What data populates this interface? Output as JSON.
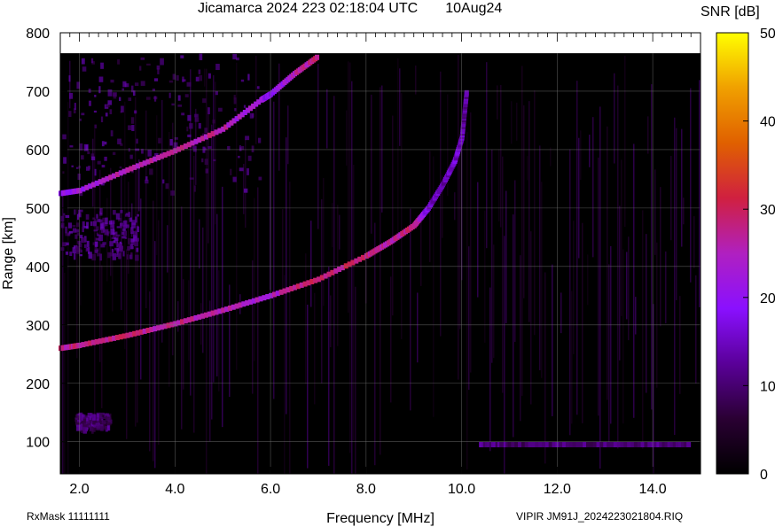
{
  "header": {
    "title": "Jicamarca 2024 223 02:18:04 UTC       10Aug24",
    "colorbar_label": "SNR [dB]"
  },
  "footer": {
    "left": "RxMask 11111111",
    "right": "VIPIR  JM91J_2024223021804.RIQ"
  },
  "chart_data": {
    "type": "heatmap",
    "xlabel": "Frequency [MHz]",
    "ylabel": "Range [km]",
    "xlim": [
      1.6,
      15.0
    ],
    "ylim": [
      45,
      800
    ],
    "data_top_range": 765,
    "x_ticks": [
      2.0,
      4.0,
      6.0,
      8.0,
      10.0,
      12.0,
      14.0
    ],
    "x_tick_labels": [
      "2.0",
      "4.0",
      "6.0",
      "8.0",
      "10.0",
      "12.0",
      "14.0"
    ],
    "y_ticks": [
      100,
      200,
      300,
      400,
      500,
      600,
      700,
      800
    ],
    "y_tick_labels": [
      "100",
      "200",
      "300",
      "400",
      "500",
      "600",
      "700",
      "800"
    ],
    "grid": true,
    "colorbar": {
      "range": [
        0,
        50
      ],
      "ticks": [
        0,
        10,
        20,
        30,
        40,
        50
      ],
      "tick_labels": [
        "0",
        "10",
        "20",
        "30",
        "40",
        "50"
      ],
      "colormap": [
        "#000000",
        "#2a0033",
        "#5a0099",
        "#8a10ff",
        "#b020c0",
        "#d02040",
        "#e06000",
        "#f0a000",
        "#ffff00"
      ]
    },
    "traces": [
      {
        "name": "F-region O-trace",
        "points": [
          [
            1.6,
            260
          ],
          [
            2.0,
            265
          ],
          [
            3.0,
            282
          ],
          [
            4.0,
            302
          ],
          [
            5.0,
            325
          ],
          [
            6.0,
            350
          ],
          [
            7.0,
            378
          ],
          [
            8.0,
            418
          ],
          [
            8.5,
            442
          ],
          [
            9.0,
            470
          ],
          [
            9.3,
            500
          ],
          [
            9.6,
            540
          ],
          [
            9.85,
            580
          ],
          [
            10.0,
            620
          ],
          [
            10.05,
            660
          ],
          [
            10.1,
            700
          ]
        ],
        "snr_db": [
          27,
          28,
          28,
          27,
          26,
          24,
          30,
          28,
          27,
          28,
          16,
          14,
          16,
          14,
          12,
          12
        ]
      },
      {
        "name": "Multi-hop trace",
        "points": [
          [
            1.6,
            525
          ],
          [
            2.0,
            530
          ],
          [
            3.0,
            565
          ],
          [
            4.0,
            598
          ],
          [
            5.0,
            635
          ],
          [
            5.8,
            685
          ],
          [
            6.0,
            695
          ],
          [
            6.5,
            730
          ],
          [
            7.0,
            760
          ]
        ],
        "snr_db": [
          20,
          22,
          26,
          27,
          26,
          20,
          18,
          26,
          28
        ]
      },
      {
        "name": "E-region echo",
        "points": [
          [
            10.4,
            95
          ],
          [
            11.0,
            95
          ],
          [
            12.0,
            95
          ],
          [
            13.0,
            95
          ],
          [
            14.0,
            95
          ],
          [
            14.8,
            95
          ]
        ],
        "snr_db": [
          12,
          10,
          11,
          10,
          11,
          10
        ]
      }
    ],
    "spread_regions": [
      {
        "name": "Spread echo 420-500 km",
        "freq_range": [
          1.6,
          3.2
        ],
        "range_km": [
          420,
          500
        ],
        "snr_db": 12
      },
      {
        "name": "Spread echo above 530 km",
        "freq_range": [
          1.6,
          5.8
        ],
        "range_km": [
          530,
          765
        ],
        "snr_db": 11
      },
      {
        "name": "Low-range patch",
        "freq_range": [
          1.9,
          2.6
        ],
        "range_km": [
          125,
          150
        ],
        "snr_db": 10
      }
    ]
  }
}
